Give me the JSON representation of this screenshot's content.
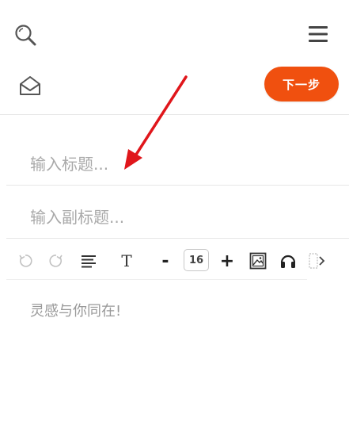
{
  "header": {
    "search_icon": "search-icon",
    "menu_icon": "hamburger-menu-icon",
    "mail_icon": "envelope-open-icon",
    "next_label": "下一步",
    "accent": "#f0500f"
  },
  "form": {
    "title_placeholder": "输入标题...",
    "subtitle_placeholder": "输入副标题..."
  },
  "toolbar": {
    "undo_icon": "undo-icon",
    "redo_icon": "redo-icon",
    "align_icon": "align-lines-icon",
    "text_style_label": "T",
    "decrease_label": "-",
    "font_size": "16",
    "increase_label": "+",
    "image_icon": "image-icon",
    "audio_icon": "headphones-icon",
    "more_icon": "more-chevron-icon"
  },
  "editor": {
    "placeholder": "灵感与你同在!"
  }
}
